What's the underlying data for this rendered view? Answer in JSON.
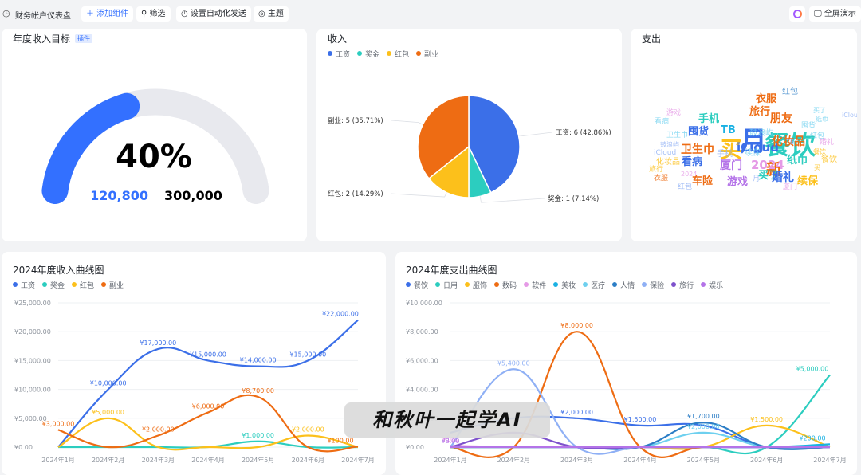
{
  "toolbar": {
    "title": "财务帐户仪表盘",
    "add_widget": "添加组件",
    "filter": "筛选",
    "auto_send": "设置自动化发送",
    "theme": "主题",
    "fullscreen": "全屏演示"
  },
  "goal": {
    "title": "年度收入目标",
    "badge": "插件",
    "percent_label": "40%",
    "progress": 0.4,
    "current": "120,800",
    "target": "300,000",
    "color": "#3370ff"
  },
  "colors": {
    "income": [
      "#3b6fe8",
      "#2ccdbf",
      "#fcc01b",
      "#ee6c13"
    ],
    "expense": [
      "#3b6fe8",
      "#2ccdbf",
      "#fcc01b",
      "#ee6c13",
      "#e59ae6",
      "#1ab1e3",
      "#6ed0ef",
      "#2c7ec6",
      "#8fb0f5",
      "#7e52cc",
      "#b473e8"
    ]
  },
  "income_pie": {
    "title": "收入",
    "chart_data": {
      "type": "pie",
      "legend": "top-left",
      "slices": [
        {
          "name": "工资",
          "value": 6,
          "label": "工资: 6 (42.86%)"
        },
        {
          "name": "奖金",
          "value": 1,
          "label": "奖金: 1 (7.14%)"
        },
        {
          "name": "红包",
          "value": 2,
          "label": "红包: 2 (14.29%)"
        },
        {
          "name": "副业",
          "value": 5,
          "label": "副业: 5 (35.71%)"
        }
      ]
    }
  },
  "expense_cloud": {
    "title": "支出",
    "words": [
      {
        "t": "月",
        "c": "#3b6fe8"
      },
      {
        "t": "餐饮",
        "c": "#2ccdbf"
      },
      {
        "t": "买",
        "c": "#fcc01b"
      },
      {
        "t": "iCloud",
        "c": "#3b6fe8"
      },
      {
        "t": "新",
        "c": "#ee6c13"
      },
      {
        "t": "2024",
        "c": "#e59ae6"
      },
      {
        "t": "卫生巾",
        "c": "#ee6c13"
      },
      {
        "t": "囤货",
        "c": "#3b6fe8"
      },
      {
        "t": "手机",
        "c": "#2ccdbf"
      },
      {
        "t": "TB",
        "c": "#1ab1e3"
      },
      {
        "t": "旅行",
        "c": "#ee6c13"
      },
      {
        "t": "朋友",
        "c": "#ee6c13"
      },
      {
        "t": "衣服",
        "c": "#ee6c13"
      },
      {
        "t": "红包",
        "c": "#2c7ec6"
      },
      {
        "t": "化妆品",
        "c": "#ee6c13"
      },
      {
        "t": "纸巾",
        "c": "#2ccdbf"
      },
      {
        "t": "看病",
        "c": "#3b6fe8"
      },
      {
        "t": "厦门",
        "c": "#b473e8"
      },
      {
        "t": "买了",
        "c": "#2ccdbf"
      },
      {
        "t": "婚礼",
        "c": "#3b6fe8"
      },
      {
        "t": "续保",
        "c": "#fcc01b"
      },
      {
        "t": "车险",
        "c": "#ee6c13"
      },
      {
        "t": "游戏",
        "c": "#b473e8"
      },
      {
        "t": "鼓浪屿",
        "c": "#6ed0ef"
      },
      {
        "t": "游戏",
        "c": "#e59ae6"
      },
      {
        "t": "红包",
        "c": "#6ed0ef"
      },
      {
        "t": "买了",
        "c": "#6ed0ef"
      },
      {
        "t": "纸巾",
        "c": "#6ed0ef"
      },
      {
        "t": "囤货",
        "c": "#6ed0ef"
      },
      {
        "t": "看病",
        "c": "#6ed0ef"
      },
      {
        "t": "卫生巾",
        "c": "#6ed0ef"
      },
      {
        "t": "红包",
        "c": "#8fb0f5"
      },
      {
        "t": "iCloud",
        "c": "#8fb0f5"
      },
      {
        "t": "iCloud",
        "c": "#8fb0f5"
      },
      {
        "t": "鼓浪屿",
        "c": "#8fb0f5"
      },
      {
        "t": "婚礼",
        "c": "#e59ae6"
      },
      {
        "t": "旅行",
        "c": "#fcc01b"
      },
      {
        "t": "化妆品",
        "c": "#fcc01b"
      },
      {
        "t": "2024",
        "c": "#e59ae6"
      },
      {
        "t": "餐饮",
        "c": "#fcc01b"
      },
      {
        "t": "衣服",
        "c": "#ee6c13"
      },
      {
        "t": "手机",
        "c": "#8fb0f5"
      },
      {
        "t": "续保",
        "c": "#6ed0ef"
      },
      {
        "t": "厦门",
        "c": "#e59ae6"
      },
      {
        "t": "买",
        "c": "#fcc01b"
      },
      {
        "t": "TB",
        "c": "#8fb0f5"
      },
      {
        "t": "餐饮",
        "c": "#fcc01b"
      },
      {
        "t": "月",
        "c": "#8fb0f5"
      }
    ]
  },
  "income_line": {
    "title": "2024年度收入曲线图",
    "chart_data": {
      "type": "line",
      "categories": [
        "2024年1月",
        "2024年2月",
        "2024年3月",
        "2024年4月",
        "2024年5月",
        "2024年6月",
        "2024年7月"
      ],
      "ylim": [
        0,
        25000
      ],
      "yticks": [
        "¥0.00",
        "¥5,000.00",
        "¥10,000.00",
        "¥15,000.00",
        "¥20,000.00",
        "¥25,000.00"
      ],
      "grid": true,
      "legend": "top-left",
      "series": [
        {
          "name": "工资",
          "values": [
            0,
            10000,
            17000,
            15000,
            14000,
            15000,
            22000
          ],
          "labels": [
            "",
            "¥10,000.00",
            "¥17,000.00",
            "¥15,000.00",
            "¥14,000.00",
            "¥15,000.00",
            "¥22,000.00"
          ]
        },
        {
          "name": "奖金",
          "values": [
            0,
            0,
            0,
            0,
            1000,
            0,
            0
          ],
          "labels": [
            "",
            "",
            "",
            "",
            "¥1,000.00",
            "",
            ""
          ]
        },
        {
          "name": "红包",
          "values": [
            0,
            5000,
            0,
            0,
            0,
            2000,
            0
          ],
          "labels": [
            "",
            "¥5,000.00",
            "",
            "",
            "",
            "¥2,000.00",
            ""
          ]
        },
        {
          "name": "副业",
          "values": [
            3000,
            0,
            2000,
            6000,
            8700,
            0,
            100
          ],
          "labels": [
            "¥3,000.00",
            "",
            "¥2,000.00",
            "¥6,000.00",
            "¥8,700.00",
            "",
            "¥100.00"
          ]
        }
      ]
    }
  },
  "expense_line": {
    "title": "2024年度支出曲线图",
    "chart_data": {
      "type": "line",
      "categories": [
        "2024年1月",
        "2024年2月",
        "2024年3月",
        "2024年4月",
        "2024年5月",
        "2024年6月",
        "2024年7月"
      ],
      "ylim": [
        0,
        10000
      ],
      "yticks": [
        "¥0.00",
        "¥2,000.00",
        "¥4,000.00",
        "¥6,000.00",
        "¥8,000.00",
        "¥10,000.00"
      ],
      "grid": true,
      "legend": "top-left",
      "series": [
        {
          "name": "餐饮",
          "values": [
            1000,
            2000,
            2000,
            1500,
            1500,
            0,
            0
          ],
          "labels": [
            "",
            "",
            "¥2,000.00",
            "¥1,500.00",
            "",
            "",
            ""
          ]
        },
        {
          "name": "日用",
          "values": [
            0,
            0,
            0,
            0,
            0,
            0,
            5000
          ],
          "labels": [
            "",
            "",
            "",
            "",
            "",
            "",
            "¥5,000.00"
          ]
        },
        {
          "name": "服饰",
          "values": [
            0,
            0,
            0,
            0,
            0,
            1500,
            0
          ],
          "labels": [
            "",
            "",
            "",
            "",
            "",
            "¥1,500.00",
            ""
          ]
        },
        {
          "name": "数码",
          "values": [
            0,
            0,
            8000,
            0,
            0,
            0,
            0
          ],
          "labels": [
            "",
            "",
            "¥8,000.00",
            "",
            "",
            "",
            ""
          ]
        },
        {
          "name": "软件",
          "values": [
            100,
            0,
            0,
            0,
            0,
            0,
            0
          ],
          "labels": [
            "¥100",
            "",
            "",
            "",
            "",
            "",
            ""
          ]
        },
        {
          "name": "美妆",
          "values": [
            0,
            0,
            0,
            0,
            0,
            0,
            200
          ],
          "labels": [
            "",
            "",
            "",
            "",
            "",
            "",
            "¥200.00"
          ]
        },
        {
          "name": "医疗",
          "values": [
            0,
            0,
            0,
            0,
            1000,
            0,
            0
          ],
          "labels": [
            "",
            "",
            "",
            "",
            "¥2,000.00",
            "",
            ""
          ]
        },
        {
          "name": "人情",
          "values": [
            0,
            0,
            0,
            0,
            1700,
            0,
            0
          ],
          "labels": [
            "",
            "",
            "",
            "",
            "¥1,700.00",
            "",
            ""
          ]
        },
        {
          "name": "保险",
          "values": [
            0,
            5400,
            0,
            0,
            0,
            0,
            0
          ],
          "labels": [
            "",
            "¥5,400.00",
            "",
            "",
            "",
            "",
            ""
          ]
        },
        {
          "name": "旅行",
          "values": [
            0,
            1000,
            0,
            0,
            0,
            0,
            0
          ],
          "labels": [
            "",
            "",
            "",
            "",
            "",
            "",
            ""
          ]
        },
        {
          "name": "娱乐",
          "values": [
            8,
            0,
            0,
            0,
            0,
            0,
            0
          ],
          "labels": [
            "¥8.00",
            "",
            "",
            "",
            "",
            "",
            ""
          ]
        }
      ]
    }
  },
  "watermark": "和秋叶一起学AI"
}
